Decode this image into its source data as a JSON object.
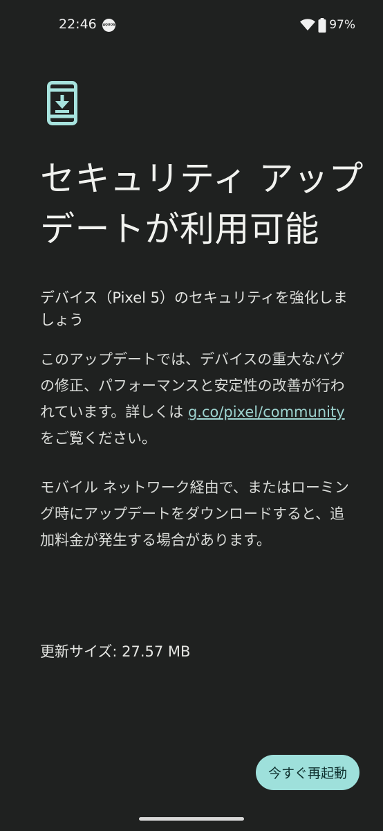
{
  "status_bar": {
    "time": "22:46",
    "badge": "AQUOS",
    "battery": "97%",
    "icons": [
      "wifi-icon",
      "battery-icon"
    ]
  },
  "page": {
    "icon": "phone-download-icon",
    "title": "セキュリティ アップデートが利用可能",
    "subtitle": "デバイス（Pixel 5）のセキュリティを強化しましょう",
    "description": {
      "text_before": "このアップデートでは、デバイスの重大なバグの修正、パフォーマンスと安定性の改善が行われています。詳しくは ",
      "link": "g.co/pixel/community",
      "text_after": " をご覧ください。"
    },
    "mobile_warning": "モバイル ネットワーク経由で、またはローミング時にアップデートをダウンロードすると、追加料金が発生する場合があります。",
    "update_size": "更新サイズ: 27.57 MB"
  },
  "actions": {
    "restart_label": "今すぐ再起動"
  },
  "colors": {
    "background": "#1f2120",
    "accent": "#9ee0db",
    "link": "#9dd3cf"
  }
}
